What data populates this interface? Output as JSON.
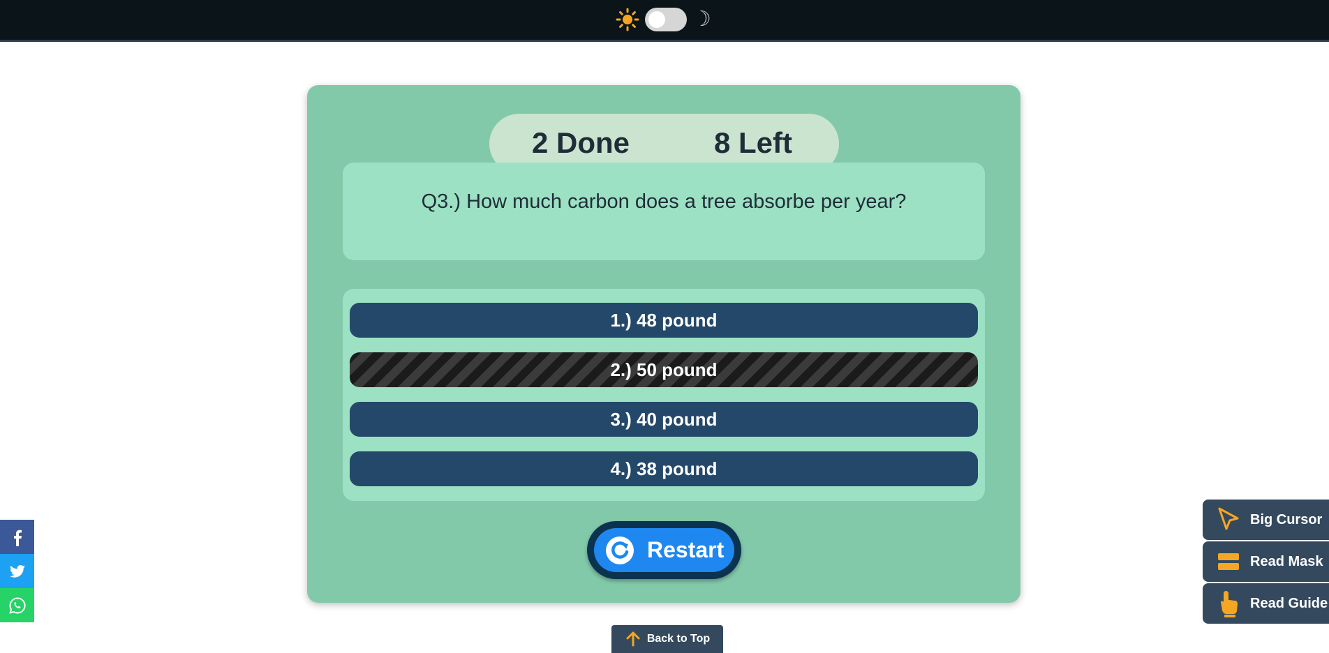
{
  "theme": {
    "light_icon": "sun-icon",
    "dark_icon": "moon-icon",
    "moon_glyph": "☽",
    "accent_color": "#f5a623"
  },
  "quiz": {
    "progress": {
      "done": "2 Done",
      "left": "8 Left"
    },
    "question": "Q3.) How much carbon does a tree absorbe per year?",
    "answers": [
      {
        "label": "1.) 48 pound"
      },
      {
        "label": "2.) 50 pound",
        "selected": true
      },
      {
        "label": "3.) 40 pound"
      },
      {
        "label": "4.) 38 pound"
      }
    ],
    "restart_label": "Restart"
  },
  "back_to_top_label": "Back to Top",
  "social": [
    "facebook-icon",
    "twitter-icon",
    "whatsapp-icon"
  ],
  "accessibility": {
    "big_cursor": "Big Cursor",
    "read_mask": "Read Mask",
    "read_guide": "Read Guide"
  }
}
